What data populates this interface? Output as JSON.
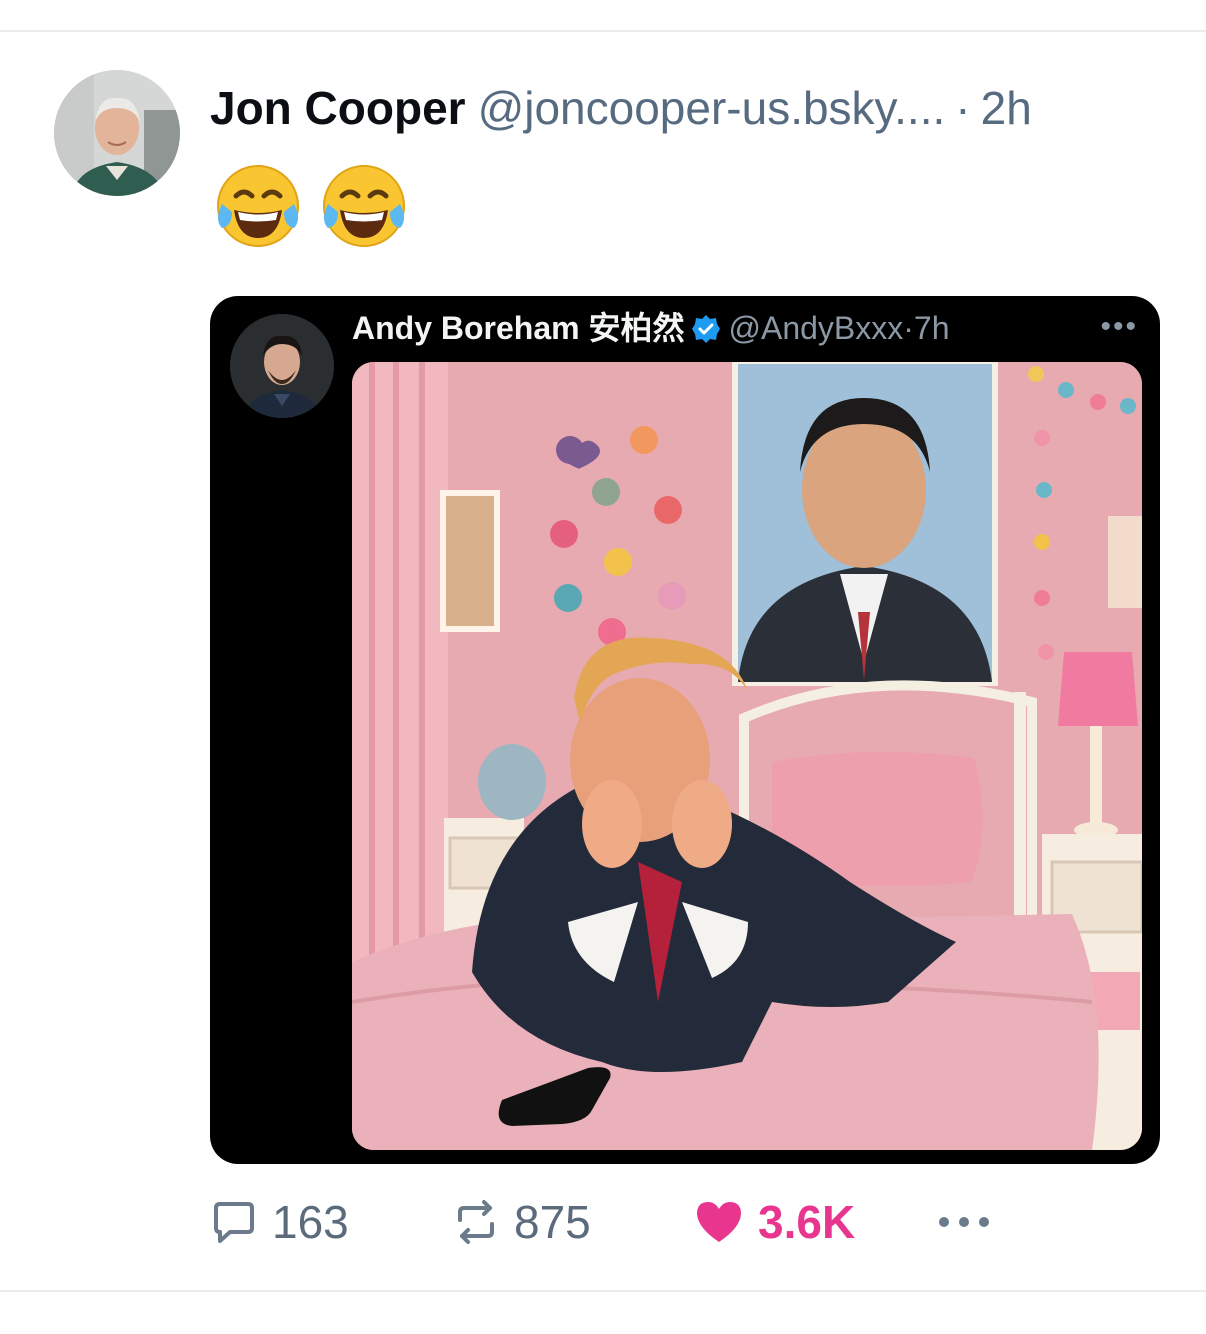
{
  "post": {
    "author_name": "Jon Cooper",
    "handle": "@joncooper-us.bsky....",
    "separator": "·",
    "timestamp": "2h",
    "emojis": [
      "face-with-tears-of-joy",
      "face-with-tears-of-joy"
    ]
  },
  "embed": {
    "author_name": "Andy Boreham 安柏然",
    "verified": true,
    "handle": "@AndyBxxx",
    "separator": "·",
    "timestamp": "7h",
    "more_icon": "ellipsis-icon"
  },
  "actions": {
    "reply_count": "163",
    "repost_count": "875",
    "like_count": "3.6K",
    "liked": true,
    "more_icon": "ellipsis-icon"
  },
  "colors": {
    "like_active": "#e8368f",
    "secondary_text": "#566a80",
    "verified_blue": "#1d9bf0"
  }
}
